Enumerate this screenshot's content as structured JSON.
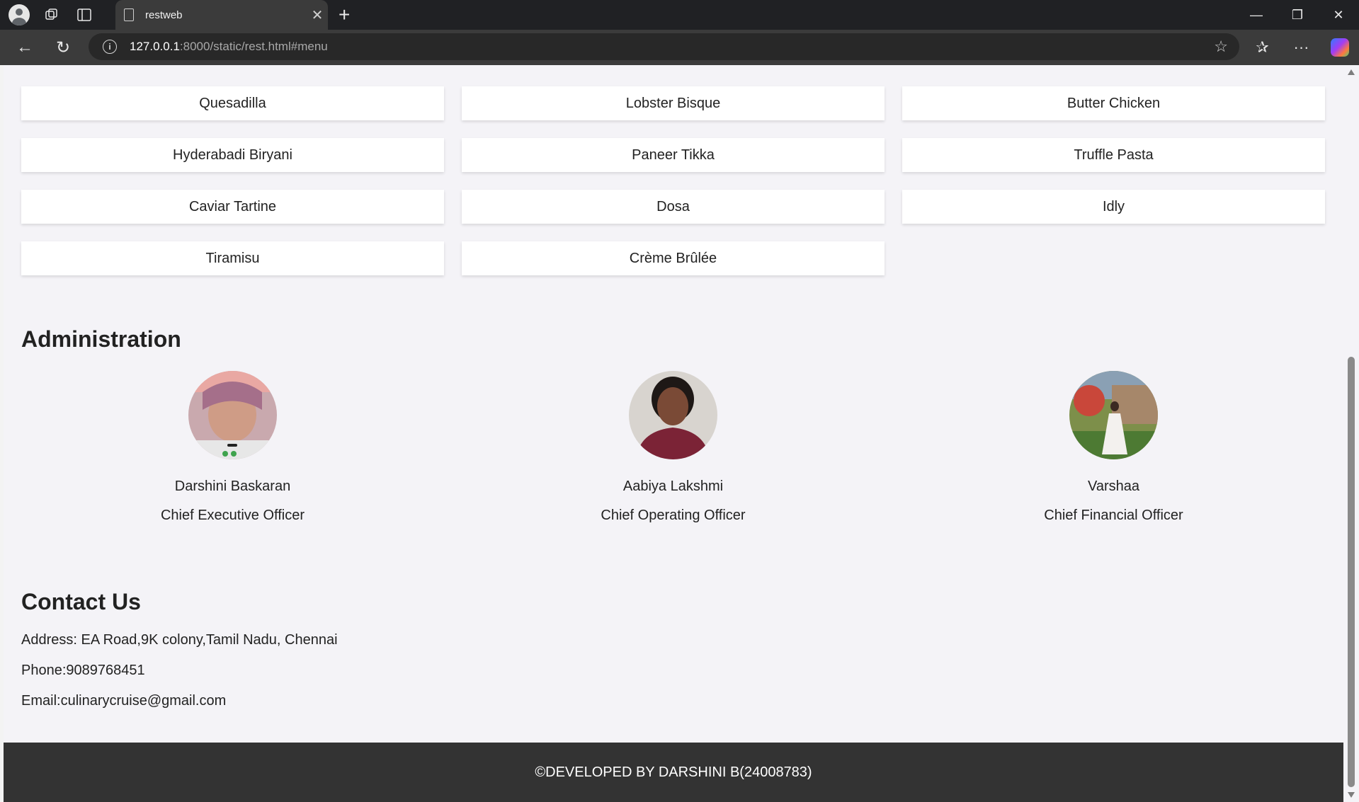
{
  "browser": {
    "tab_title": "restweb",
    "url_host": "127.0.0.1",
    "url_path": ":8000/static/rest.html#menu"
  },
  "menu": {
    "items": [
      "Quesadilla",
      "Lobster Bisque",
      "Butter Chicken",
      "Hyderabadi Biryani",
      "Paneer Tikka",
      "Truffle Pasta",
      "Caviar Tartine",
      "Dosa",
      "Idly",
      "Tiramisu",
      "Crème Brûlée"
    ]
  },
  "administration": {
    "title": "Administration",
    "people": [
      {
        "name": "Darshini Baskaran",
        "role": "Chief Executive Officer"
      },
      {
        "name": "Aabiya Lakshmi",
        "role": "Chief Operating Officer"
      },
      {
        "name": "Varshaa",
        "role": "Chief Financial Officer"
      }
    ]
  },
  "contact": {
    "title": "Contact Us",
    "address": "Address: EA Road,9K colony,Tamil Nadu, Chennai",
    "phone": "Phone:9089768451",
    "email": "Email:culinarycruise@gmail.com"
  },
  "footer": {
    "text": "©DEVELOPED BY DARSHINI B(24008783)"
  }
}
